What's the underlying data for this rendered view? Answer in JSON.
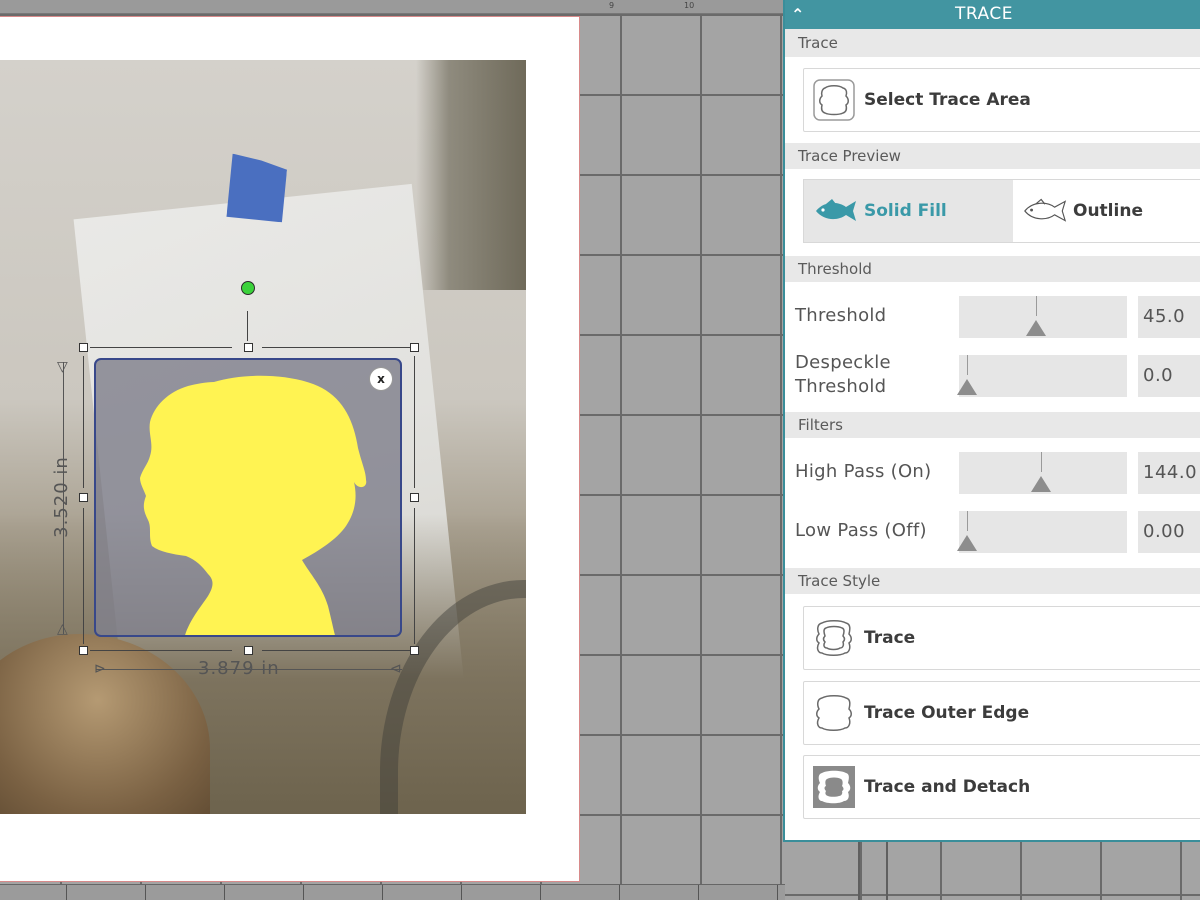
{
  "canvas": {
    "ruler_numbers": [
      "9",
      "10"
    ],
    "dimension_width": "3.879 in",
    "dimension_height": "3.520 in",
    "close_symbol": "x",
    "colors": {
      "selection_border": "#38488a",
      "traced_fill": "#fff352",
      "rotate_handle": "#3bd23b",
      "mat_border": "#d88a8a"
    }
  },
  "panel": {
    "title": "TRACE",
    "collapse_icon": "chevron-up-icon",
    "accent_color": "#4295a1",
    "sections": {
      "trace": "Trace",
      "trace_preview": "Trace Preview",
      "threshold": "Threshold",
      "filters": "Filters",
      "trace_style": "Trace Style"
    },
    "select_trace_area": {
      "label": "Select Trace Area",
      "icon": "trace-area-icon"
    },
    "preview": {
      "solid_fill": {
        "label": "Solid Fill",
        "icon": "fish-solid-icon",
        "selected": true
      },
      "outline": {
        "label": "Outline",
        "icon": "fish-outline-icon",
        "selected": false
      }
    },
    "sliders": {
      "threshold": {
        "label": "Threshold",
        "value": "45.0",
        "position": 0.46
      },
      "despeckle": {
        "label_line1": "Despeckle",
        "label_line2": "Threshold",
        "value": "0.0",
        "position": 0.05
      },
      "high_pass": {
        "label": "High Pass (On)",
        "value": "144.0",
        "position": 0.49
      },
      "low_pass": {
        "label": "Low Pass (Off)",
        "value": "0.00",
        "position": 0.05
      }
    },
    "trace_style": {
      "trace": {
        "label": "Trace",
        "icon": "trace-cloud-icon"
      },
      "trace_outer_edge": {
        "label": "Trace Outer Edge",
        "icon": "trace-outer-edge-icon"
      },
      "trace_and_detach": {
        "label": "Trace and Detach",
        "icon": "trace-detach-icon"
      }
    }
  }
}
